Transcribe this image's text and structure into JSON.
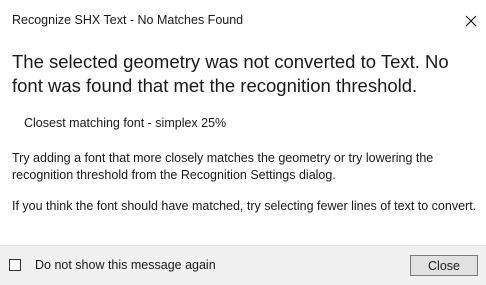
{
  "window": {
    "title": "Recognize SHX Text - No Matches Found"
  },
  "message": {
    "headline": "The selected geometry was not converted to Text.  No font was found that met the recognition threshold.",
    "closest_match": "Closest matching font - simplex 25%",
    "paragraph_1": "Try adding a font that more closely matches the geometry or try lowering the recognition threshold from the Recognition Settings dialog.",
    "paragraph_2": "If you think the font should have matched, try selecting fewer lines of text to convert."
  },
  "footer": {
    "checkbox_label": "Do not show this message again",
    "checkbox_checked": false,
    "close_label": "Close"
  },
  "icons": {
    "close": "close-icon",
    "checkbox": "checkbox-icon"
  },
  "colors": {
    "footer_background": "#f0f0f0",
    "button_background": "#e1e1e1",
    "button_border": "#7a7a7a",
    "text": "#1a1a1a"
  }
}
